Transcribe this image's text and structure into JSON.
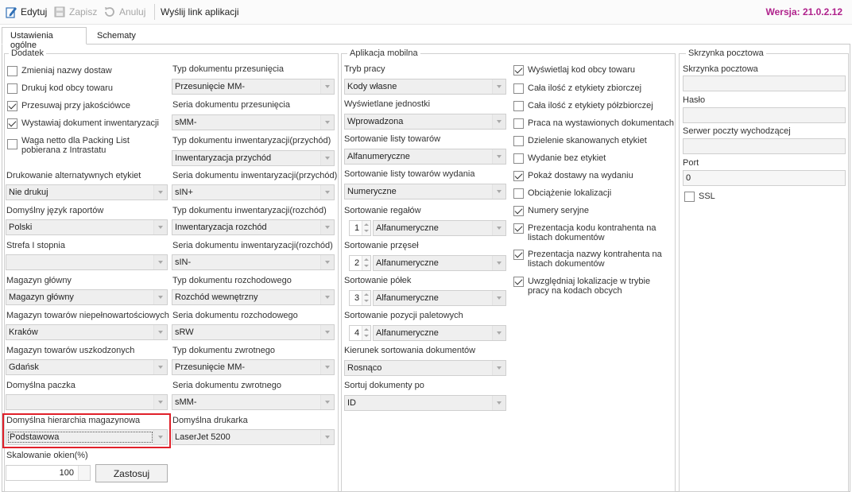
{
  "toolbar": {
    "edit": "Edytuj",
    "save": "Zapisz",
    "cancel": "Anuluj",
    "send_link": "Wyślij link aplikacji",
    "version": "Wersja: 21.0.2.12"
  },
  "tabs": [
    "Ustawienia ogólne",
    "Schematy"
  ],
  "groups": {
    "dodatek": "Dodatek",
    "mobile": "Aplikacja mobilna",
    "mailbox": "Skrzynka pocztowa"
  },
  "dodatek": {
    "checkboxes": [
      {
        "label": "Zmieniaj nazwy dostaw",
        "checked": false
      },
      {
        "label": "Drukuj kod obcy towaru",
        "checked": false
      },
      {
        "label": "Przesuwaj przy jakościówce",
        "checked": true
      },
      {
        "label": "Wystawiaj dokument inwentaryzacji",
        "checked": true
      },
      {
        "label": "Waga netto dla Packing List pobierana z Intrastatu",
        "checked": false
      }
    ],
    "left_fields": [
      {
        "label": "Drukowanie alternatywnych etykiet",
        "value": "Nie drukuj"
      },
      {
        "label": "Domyślny język raportów",
        "value": "Polski"
      },
      {
        "label": "Strefa I stopnia",
        "value": ""
      },
      {
        "label": "Magazyn główny",
        "value": "Magazyn główny"
      },
      {
        "label": "Magazyn towarów niepełnowartościowych",
        "value": "Kraków"
      },
      {
        "label": "Magazyn towarów uszkodzonych",
        "value": "Gdańsk"
      },
      {
        "label": "Domyślna paczka",
        "value": ""
      },
      {
        "label": "Domyślna hierarchia magazynowa",
        "value": "Podstawowa"
      }
    ],
    "right_fields": [
      {
        "label": "Typ dokumentu przesunięcia",
        "value": "Przesunięcie MM-"
      },
      {
        "label": "Seria dokumentu przesunięcia",
        "value": "sMM-"
      },
      {
        "label": "Typ dokumentu inwentaryzacji(przychód)",
        "value": "Inwentaryzacja przychód"
      },
      {
        "label": "Seria dokumentu inwentaryzacji(przychód)",
        "value": "sIN+"
      },
      {
        "label": "Typ dokumentu inwentaryzacji(rozchód)",
        "value": "Inwentaryzacja rozchód"
      },
      {
        "label": "Seria dokumentu inwentaryzacji(rozchód)",
        "value": "sIN-"
      },
      {
        "label": "Typ dokumentu rozchodowego",
        "value": "Rozchód wewnętrzny"
      },
      {
        "label": "Seria dokumentu rozchodowego",
        "value": "sRW"
      },
      {
        "label": "Typ dokumentu zwrotnego",
        "value": "Przesunięcie MM-"
      },
      {
        "label": "Seria dokumentu zwrotnego",
        "value": "sMM-"
      },
      {
        "label": "Domyślna drukarka",
        "value": "LaserJet 5200"
      }
    ],
    "scaling_label": "Skalowanie okien(%)",
    "scaling_value": "100",
    "apply": "Zastosuj"
  },
  "mobile": {
    "fields": [
      {
        "label": "Tryb pracy",
        "value": "Kody własne"
      },
      {
        "label": "Wyświetlane jednostki",
        "value": "Wprowadzona"
      },
      {
        "label": "Sortowanie listy towarów",
        "value": "Alfanumeryczne"
      },
      {
        "label": "Sortowanie listy towarów wydania",
        "value": "Numeryczne"
      }
    ],
    "sort_fields": [
      {
        "label": "Sortowanie regałów",
        "order": "1",
        "value": "Alfanumeryczne"
      },
      {
        "label": "Sortowanie przęseł",
        "order": "2",
        "value": "Alfanumeryczne"
      },
      {
        "label": "Sortowanie półek",
        "order": "3",
        "value": "Alfanumeryczne"
      },
      {
        "label": "Sortowanie pozycji paletowych",
        "order": "4",
        "value": "Alfanumeryczne"
      }
    ],
    "fields2": [
      {
        "label": "Kierunek sortowania dokumentów",
        "value": "Rosnąco"
      },
      {
        "label": "Sortuj dokumenty po",
        "value": "ID"
      }
    ],
    "checkboxes": [
      {
        "label": "Wyświetlaj kod obcy towaru",
        "checked": true
      },
      {
        "label": "Cała ilość z etykiety zbiorczej",
        "checked": false
      },
      {
        "label": "Cała ilość z etykiety półzbiorczej",
        "checked": false
      },
      {
        "label": "Praca na wystawionych dokumentach",
        "checked": false
      },
      {
        "label": "Dzielenie skanowanych etykiet",
        "checked": false
      },
      {
        "label": "Wydanie bez etykiet",
        "checked": false
      },
      {
        "label": "Pokaż dostawy na wydaniu",
        "checked": true
      },
      {
        "label": "Obciążenie lokalizacji",
        "checked": false
      },
      {
        "label": "Numery seryjne",
        "checked": true
      },
      {
        "label": "Prezentacja kodu kontrahenta na listach dokumentów",
        "checked": true
      },
      {
        "label": "Prezentacja nazwy kontrahenta na listach dokumentów",
        "checked": true
      },
      {
        "label": "Uwzględniaj lokalizacje w trybie pracy na kodach obcych",
        "checked": true
      }
    ]
  },
  "mailbox": {
    "mailbox_label": "Skrzynka pocztowa",
    "mailbox_value": "",
    "password_label": "Hasło",
    "password_value": "",
    "smtp_label": "Serwer poczty wychodzącej",
    "smtp_value": "",
    "port_label": "Port",
    "port_value": "0",
    "ssl_label": "SSL",
    "ssl_checked": false
  }
}
